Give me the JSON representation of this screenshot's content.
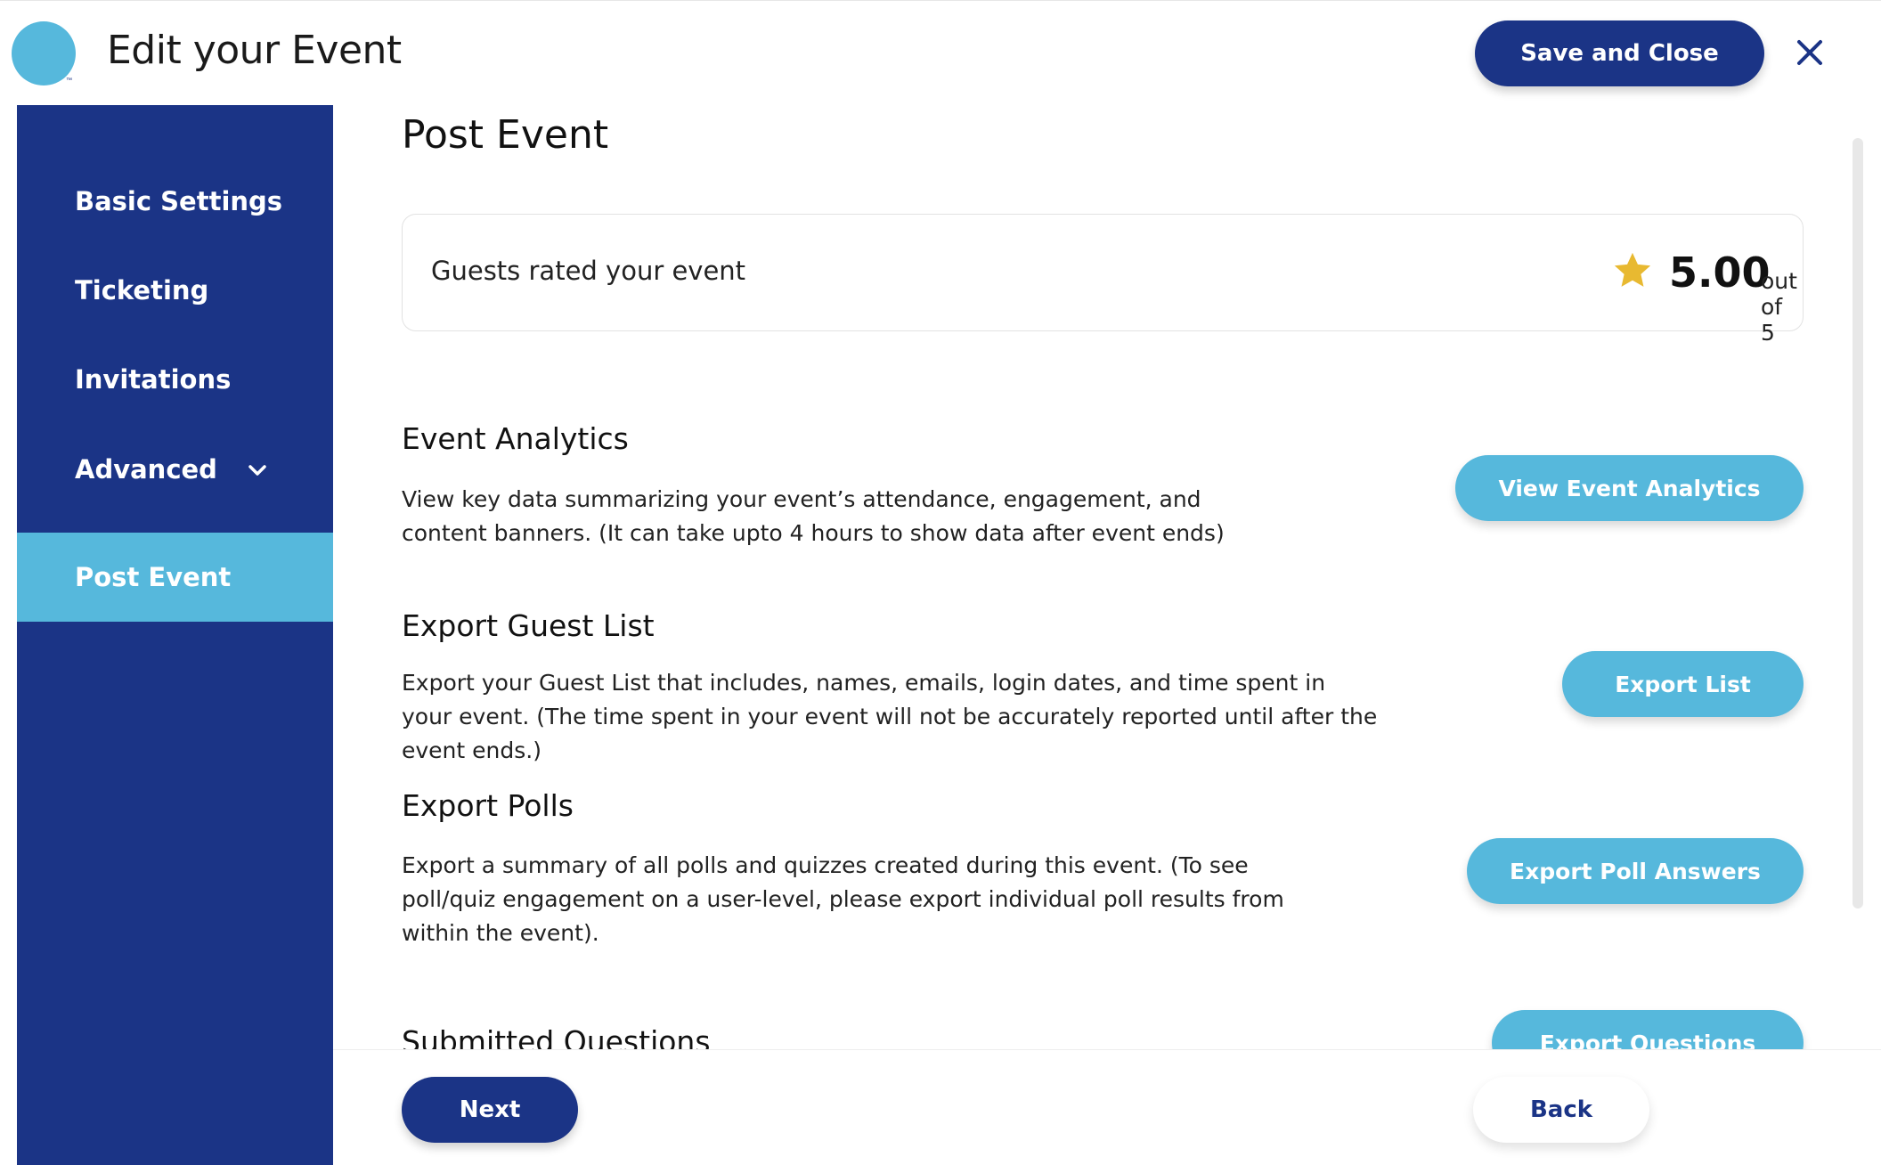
{
  "header": {
    "title": "Edit your Event",
    "logo_mark": "™",
    "save_close_label": "Save and Close",
    "close_icon": "close-icon"
  },
  "sidebar": {
    "items": [
      {
        "label": "Basic Settings",
        "active": false
      },
      {
        "label": "Ticketing",
        "active": false
      },
      {
        "label": "Invitations",
        "active": false
      },
      {
        "label": "Advanced",
        "active": false,
        "icon": "chevron-down-icon"
      },
      {
        "label": "Post Event",
        "active": true
      }
    ]
  },
  "main": {
    "title": "Post Event",
    "rating": {
      "label": "Guests rated your event",
      "value": "5.00",
      "suffix": "out of 5",
      "icon": "star-icon"
    },
    "sections": [
      {
        "title": "Event Analytics",
        "description": "View key data summarizing your event’s attendance, engagement, and content banners. (It can take upto 4 hours to show data after event ends)",
        "button": "View Event Analytics"
      },
      {
        "title": "Export Guest List",
        "description": "Export your Guest List that includes, names, emails, login dates, and time spent in your event. (The time spent in your event will not be accurately reported until after the event ends.)",
        "button": "Export List"
      },
      {
        "title": "Export Polls",
        "description": "Export a summary of all polls and quizzes created during this event. (To see poll/quiz engagement on a user-level, please export individual poll results from within the event).",
        "button": "Export Poll Answers"
      },
      {
        "title": "Submitted Questions",
        "button": "Export Questions"
      }
    ]
  },
  "footer": {
    "next_label": "Next",
    "back_label": "Back"
  },
  "colors": {
    "navy": "#1b3486",
    "accent": "#56b8dc",
    "star": "#e8b931"
  }
}
